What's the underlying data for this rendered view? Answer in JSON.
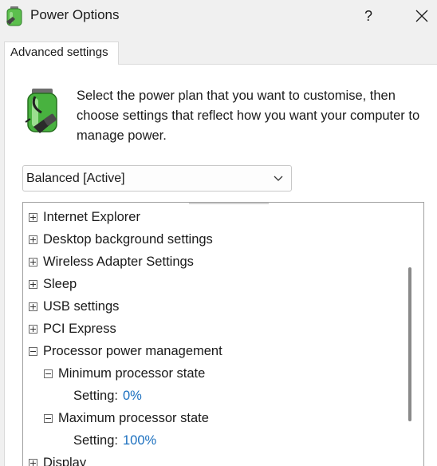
{
  "window": {
    "title": "Power Options",
    "help_label": "?"
  },
  "tabs": [
    {
      "label": "Advanced settings"
    }
  ],
  "description": "Select the power plan that you want to customise, then choose settings that reflect how you want your computer to manage power.",
  "plan_select": {
    "value": "Balanced [Active]"
  },
  "tree": {
    "nodes": [
      {
        "label": "Internet Explorer",
        "state": "collapsed"
      },
      {
        "label": "Desktop background settings",
        "state": "collapsed"
      },
      {
        "label": "Wireless Adapter Settings",
        "state": "collapsed"
      },
      {
        "label": "Sleep",
        "state": "collapsed"
      },
      {
        "label": "USB settings",
        "state": "collapsed"
      },
      {
        "label": "PCI Express",
        "state": "collapsed"
      },
      {
        "label": "Processor power management",
        "state": "expanded"
      },
      {
        "label": "Minimum processor state",
        "state": "expanded"
      },
      {
        "label": "Setting:",
        "value": "0%"
      },
      {
        "label": "Maximum processor state",
        "state": "expanded"
      },
      {
        "label": "Setting:",
        "value": "100%"
      },
      {
        "label": "Display",
        "state": "collapsed"
      }
    ]
  },
  "colors": {
    "link_value": "#1a6fbf",
    "battery_green": "#3fae3a"
  },
  "icons": {
    "app": "power-options-battery-icon",
    "help": "help-icon",
    "close": "close-icon",
    "dropdown": "chevron-down-icon"
  }
}
